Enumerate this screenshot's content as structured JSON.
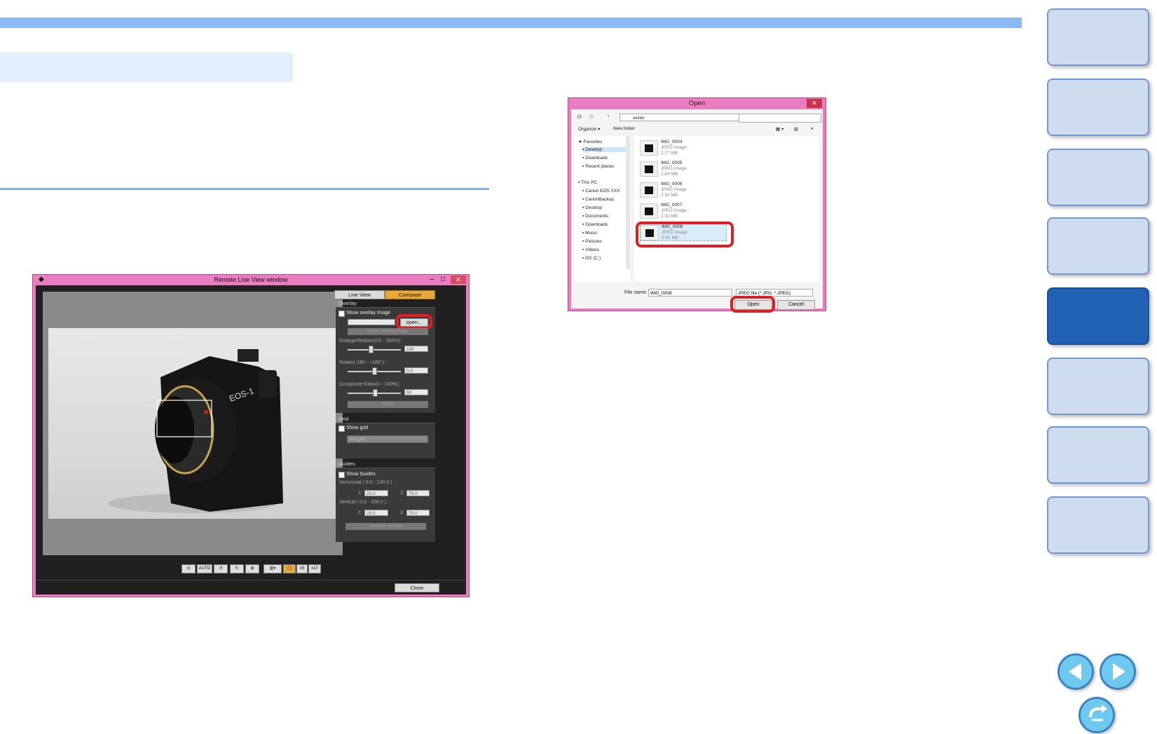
{
  "remote_window": {
    "title": "Remote Live View window",
    "tabs": [
      "Live View",
      "Compose"
    ],
    "overlay": {
      "header": "Overlay",
      "show_label": "Show overlay image",
      "open_label": "open...",
      "move_label": "Move overlay image",
      "enlarge_label": "Enlarge/Reduce(25 - 200%):",
      "enlarge_value": "100",
      "rotate_label": "Rotate(-180 - +180°):",
      "rotate_value": "0.0",
      "ratio_label": "Composite Ratio(0 - 100%):",
      "ratio_value": "50",
      "reset_label": "Reset"
    },
    "grid": {
      "header": "Grid",
      "show_label": "Show grid",
      "select_value": "3x3 grid"
    },
    "guides": {
      "header": "Guides",
      "show_label": "Show Guides",
      "horizontal_label": "Horizontal ( 0.0 - 100.0 ) :",
      "vertical_label": "Vertical ( 0.0 - 100.0 ) :",
      "n1": "1:",
      "n2": "2:",
      "h1": "25.0",
      "h2": "75.0",
      "v1": "25.0",
      "v2": "75.0",
      "detailed_label": "Detailed settings"
    },
    "toolbar": {
      "auto": "AUTO",
      "x5": "x5",
      "x10": "x10"
    },
    "close_label": "Close",
    "camera_badge": "EOS-1"
  },
  "open_dialog": {
    "title": "Open",
    "path": "xxxxx",
    "organize": "Organize ▾",
    "new_folder": "New folder",
    "nav": {
      "favorites": "Favorites",
      "desktop": "Desktop",
      "downloads": "Downloads",
      "recent": "Recent places",
      "this_pc": "This PC",
      "canon": "Canon EOS XXX",
      "backup": "CanonBackup",
      "desktop2": "Desktop",
      "documents": "Documents",
      "downloads2": "Downloads",
      "music": "Music",
      "pictures": "Pictures",
      "videos": "Videos",
      "os": "OS (C:)"
    },
    "files": [
      {
        "name": "IMG_0004",
        "type": "JPEG Image",
        "size": "2.77 MB"
      },
      {
        "name": "IMG_0005",
        "type": "JPEG Image",
        "size": "2.84 MB"
      },
      {
        "name": "IMG_0006",
        "type": "JPEG Image",
        "size": "2.32 MB"
      },
      {
        "name": "IMG_0007",
        "type": "JPEG Image",
        "size": "2.92 MB"
      },
      {
        "name": "IMG_0008",
        "type": "JPEG Image",
        "size": "2.81 MB"
      }
    ],
    "filename_label": "File name:",
    "filename_value": "IMG_0008",
    "filter_value": "JPEG file (*.JPG, *.JPEG)",
    "open_label": "Open",
    "cancel_label": "Cancel"
  },
  "colors": {
    "accent_bar": "#8ab9f5",
    "active_tab": "#2262b5",
    "highlight": "#e02020",
    "window_frame": "#ea7cc2"
  }
}
